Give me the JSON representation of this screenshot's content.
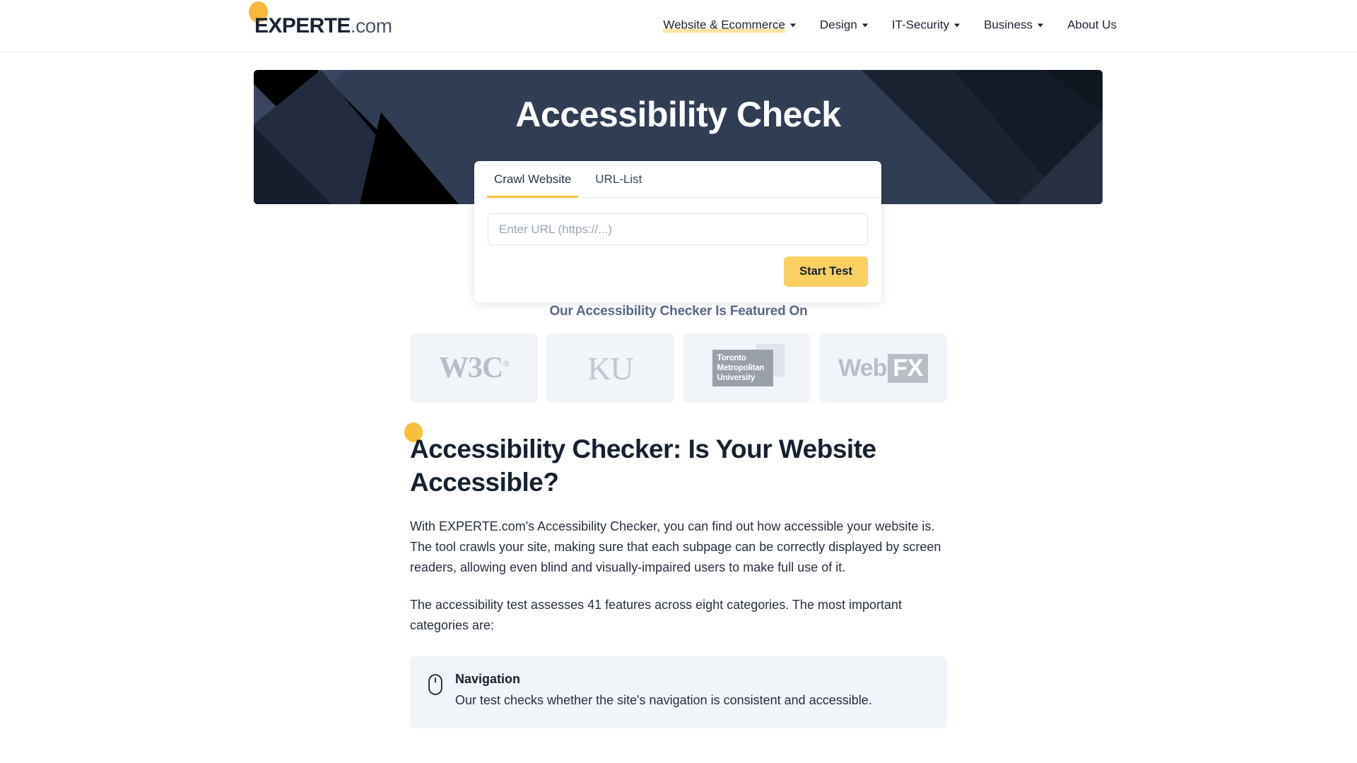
{
  "header": {
    "brand": {
      "main": "EXPERTE",
      "suffix": ".com"
    },
    "nav": [
      {
        "label": "Website & Ecommerce",
        "has_caret": true,
        "active": true
      },
      {
        "label": "Design",
        "has_caret": true,
        "active": false
      },
      {
        "label": "IT-Security",
        "has_caret": true,
        "active": false
      },
      {
        "label": "Business",
        "has_caret": true,
        "active": false
      },
      {
        "label": "About Us",
        "has_caret": false,
        "active": false
      }
    ]
  },
  "hero": {
    "title": "Accessibility Check",
    "bg_color": "#313d52",
    "bg_dark": "#151d2b"
  },
  "form": {
    "tabs": [
      {
        "label": "Crawl Website",
        "active": true
      },
      {
        "label": "URL-List",
        "active": false
      }
    ],
    "url_placeholder": "Enter URL (https://...)",
    "url_value": "",
    "submit_label": "Start Test",
    "accent_color": "#fbcf62"
  },
  "featured": {
    "heading": "Our Accessibility Checker Is Featured On",
    "logos": [
      {
        "name": "w3c",
        "text": "W3C",
        "mark": "®"
      },
      {
        "name": "ku",
        "text": "KU"
      },
      {
        "name": "toronto-metropolitan-university",
        "line1": "Toronto",
        "line2": "Metropolitan",
        "line3": "University"
      },
      {
        "name": "webfx",
        "part1": "Web",
        "part2": "FX"
      }
    ]
  },
  "article": {
    "title": "Accessibility Checker: Is Your Website Accessible?",
    "paragraph_1": "With EXPERTE.com's Accessibility Checker, you can find out how accessible your website is. The tool crawls your site, making sure that each subpage can be correctly displayed by screen readers, allowing even blind and visually-impaired users to make full use of it.",
    "paragraph_2": "The accessibility test assesses 41 features across eight categories. The most important categories are:",
    "cards": [
      {
        "icon": "mouse-icon",
        "title": "Navigation",
        "description": "Our test checks whether the site's navigation is consistent and accessible."
      }
    ]
  }
}
